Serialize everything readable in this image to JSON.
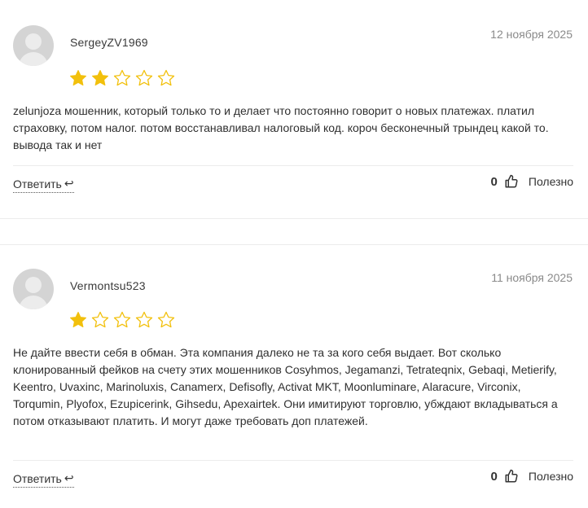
{
  "reviews": [
    {
      "username": "SergeyZV1969",
      "date": "12 ноября 2025",
      "rating": 2,
      "text": "zelunjoza мошенник, который только то и делает что постоянно говорит о новых платежах. платил страховку, потом налог. потом восстанавливал налоговый код. короч бесконечный трындец какой то. вывода так и нет",
      "reply_label": "Ответить",
      "votes": "0",
      "helpful_label": "Полезно"
    },
    {
      "username": "Vermontsu523",
      "date": "11 ноября 2025",
      "rating": 1,
      "text": "Не дайте ввести себя в обман. Эта компания далеко не та за кого себя выдает. Вот сколько клонированный фейков на счету этих мошенников Cosyhmos, Jegamanzi, Tetrateqnix, Gebaqi, Metierify, Keentro, Uvaxinc, Marinoluxis, Canamerx, Defisofly, Activat MKT, Moonluminare, Alaracure, Virconix, Torqumin, Plyofox, Ezupicerink, Gihsedu, Apexairtek. Они имитируют торговлю, убждают вкладываться а потом отказывают платить. И могут даже требовать доп платежей.",
      "reply_label": "Ответить",
      "votes": "0",
      "helpful_label": "Полезно"
    }
  ],
  "colors": {
    "star_filled": "#f2c00c",
    "star_empty_stroke": "#f2c00c"
  },
  "icons": {
    "reply": "return-arrow-icon",
    "like": "thumbs-up-icon",
    "avatar": "default-avatar-icon"
  }
}
